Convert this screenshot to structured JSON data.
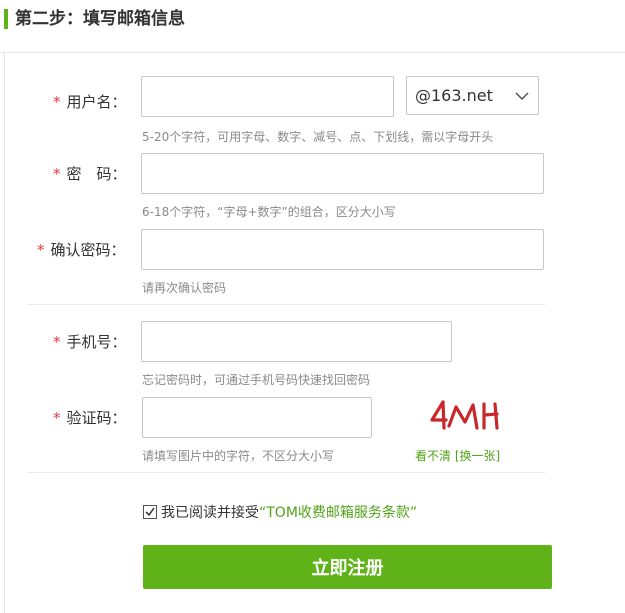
{
  "header": {
    "title": "第二步：填写邮箱信息"
  },
  "form": {
    "username": {
      "required_mark": "*",
      "label": "用户名：",
      "value": "",
      "domain_selected": "@163.net",
      "hint": "5-20个字符，可用字母、数字、减号、点、下划线，需以字母开头"
    },
    "password": {
      "required_mark": "*",
      "label": "密　码：",
      "value": "",
      "hint": "6-18个字符，“字母+数字”的组合，区分大小写"
    },
    "confirm_password": {
      "required_mark": "*",
      "label": "确认密码：",
      "value": "",
      "hint": "请再次确认密码"
    },
    "phone": {
      "required_mark": "*",
      "label": "手机号：",
      "value": "",
      "hint": "忘记密码时，可通过手机号码快速找回密码"
    },
    "captcha": {
      "required_mark": "*",
      "label": "验证码：",
      "value": "",
      "hint": "请填写图片中的字符，不区分大小写",
      "refresh_text": "看不清 [换一张]"
    },
    "agreement": {
      "checked": true,
      "prefix": "我已阅读并接受",
      "link_text": "“TOM收费邮箱服务条款”"
    },
    "submit_label": "立即注册"
  },
  "colors": {
    "accent_green": "#5fb319",
    "link_green": "#52a31a",
    "required_red": "#e4393c",
    "captcha_red": "#c8282a"
  }
}
